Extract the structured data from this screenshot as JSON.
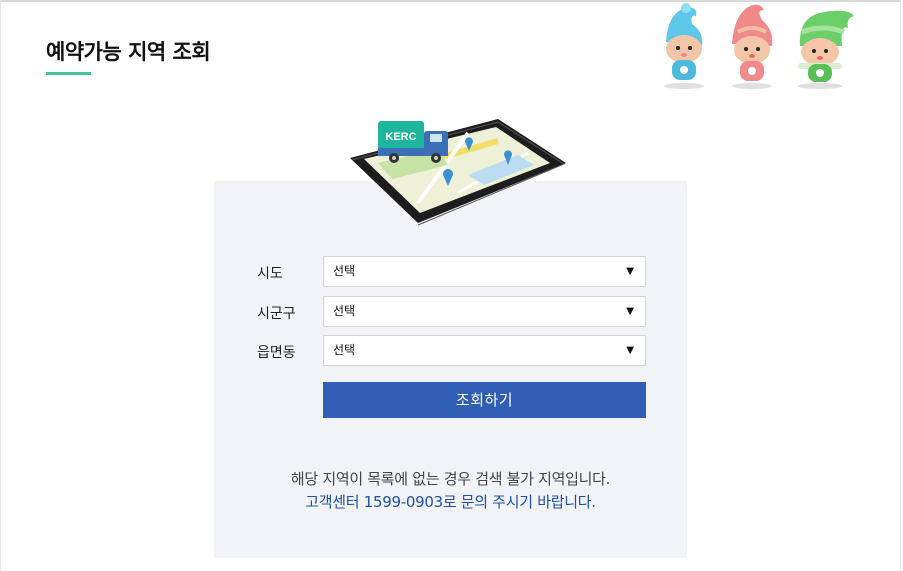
{
  "header": {
    "title": "예약가능 지역 조회",
    "accent_color": "#3fc39b"
  },
  "illustration": {
    "truck_label": "KERC"
  },
  "form": {
    "fields": [
      {
        "label": "시도",
        "value": "선택"
      },
      {
        "label": "시군구",
        "value": "선택"
      },
      {
        "label": "읍면동",
        "value": "선택"
      }
    ],
    "submit_label": "조회하기",
    "submit_color": "#2f5eb4"
  },
  "notice": {
    "line1": "해당 지역이 목록에 없는 경우 검색 불가 지역입니다.",
    "line2": "고객센터 1599-0903로 문의 주시기 바랍니다."
  },
  "icons": {
    "select_arrow": "caret-down-icon"
  }
}
